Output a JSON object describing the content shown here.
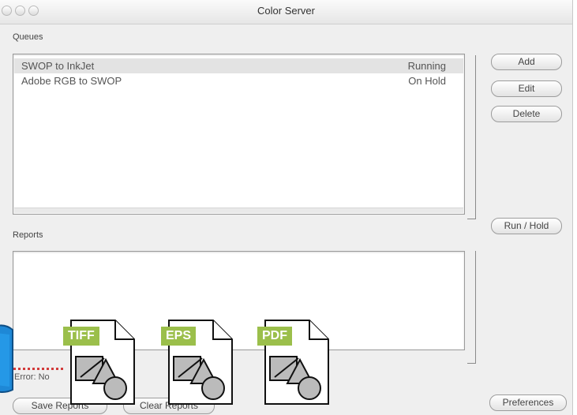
{
  "window": {
    "title": "Color Server"
  },
  "queues": {
    "label": "Queues",
    "items": [
      {
        "name": "SWOP to InkJet",
        "status": "Running",
        "selected": true
      },
      {
        "name": "Adobe RGB to SWOP",
        "status": "On Hold",
        "selected": false
      }
    ]
  },
  "buttons": {
    "add": "Add",
    "edit": "Edit",
    "delete": "Delete",
    "run_hold": "Run / Hold",
    "preferences": "Preferences",
    "save_reports": "Save Reports",
    "clear_reports": "Clear Reports"
  },
  "reports": {
    "label": "Reports"
  },
  "error": {
    "label": "Error:",
    "value": "No"
  },
  "documents": [
    {
      "type": "TIFF",
      "color": "#9bbf4b"
    },
    {
      "type": "EPS",
      "color": "#9bbf4b"
    },
    {
      "type": "PDF",
      "color": "#9bbf4b"
    }
  ]
}
